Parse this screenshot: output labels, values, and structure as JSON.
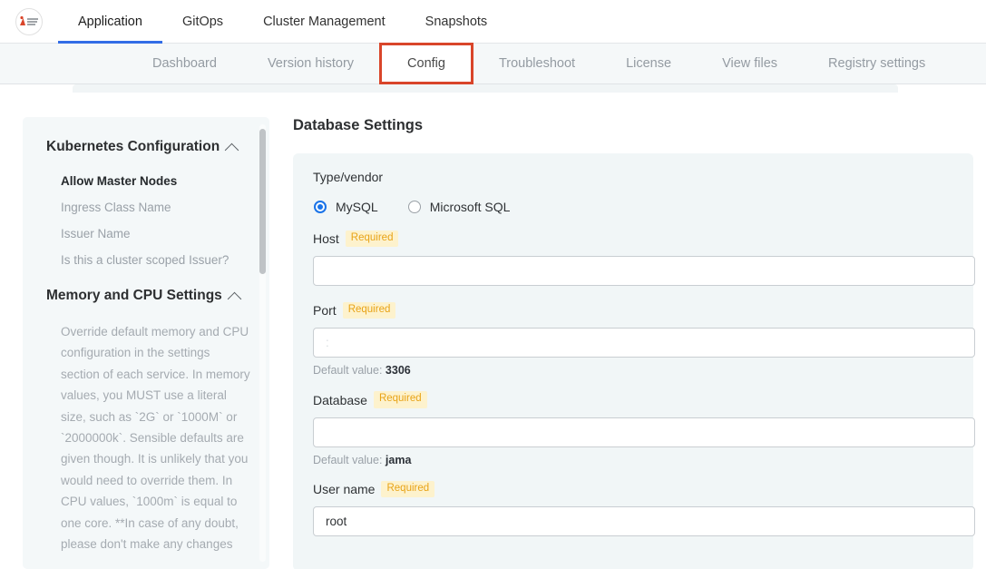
{
  "topnav": {
    "logo_name": "jama-software-logo",
    "items": [
      {
        "label": "Application",
        "active": true
      },
      {
        "label": "GitOps",
        "active": false
      },
      {
        "label": "Cluster Management",
        "active": false
      },
      {
        "label": "Snapshots",
        "active": false
      }
    ]
  },
  "subnav": {
    "items": [
      {
        "label": "Dashboard",
        "selected": false
      },
      {
        "label": "Version history",
        "selected": false
      },
      {
        "label": "Config",
        "selected": true
      },
      {
        "label": "Troubleshoot",
        "selected": false
      },
      {
        "label": "License",
        "selected": false
      },
      {
        "label": "View files",
        "selected": false
      },
      {
        "label": "Registry settings",
        "selected": false
      }
    ],
    "highlight_color": "#d9452a"
  },
  "sidebar": {
    "groups": [
      {
        "title": "Kubernetes Configuration",
        "items": [
          {
            "label": "Allow Master Nodes",
            "active": true
          },
          {
            "label": "Ingress Class Name",
            "active": false
          },
          {
            "label": "Issuer Name",
            "active": false
          },
          {
            "label": "Is this a cluster scoped Issuer?",
            "active": false
          }
        ]
      },
      {
        "title": "Memory and CPU Settings",
        "description": "Override default memory and CPU configuration in the settings section of each service. In memory values, you MUST use a literal size, such as `2G` or `1000M` or `2000000k`. Sensible defaults are given though. It is unlikely that you would need to override them. In CPU values, `1000m` is equal to one core. **In case of any doubt, please don't make any changes"
      }
    ]
  },
  "main": {
    "title": "Database Settings",
    "type_vendor": {
      "label": "Type/vendor",
      "options": [
        {
          "label": "MySQL",
          "checked": true
        },
        {
          "label": "Microsoft SQL",
          "checked": false
        }
      ]
    },
    "fields": [
      {
        "label": "Host",
        "required_badge": "Required",
        "value": "",
        "placeholder": "",
        "default_prefix": "",
        "default_value": ""
      },
      {
        "label": "Port",
        "required_badge": "Required",
        "value": "",
        "placeholder": ":",
        "default_prefix": "Default value:",
        "default_value": "3306"
      },
      {
        "label": "Database",
        "required_badge": "Required",
        "value": "",
        "placeholder": "",
        "default_prefix": "Default value:",
        "default_value": "jama"
      },
      {
        "label": "User name",
        "required_badge": "Required",
        "value": "root",
        "placeholder": "",
        "default_prefix": "",
        "default_value": ""
      }
    ]
  },
  "colors": {
    "accent_blue": "#326de6",
    "radio_blue": "#1a73e8",
    "highlight_red": "#d9452a",
    "required_badge_bg": "#fdf2cd",
    "required_badge_fg": "#e8a317",
    "panel_bg": "#f1f6f7"
  }
}
